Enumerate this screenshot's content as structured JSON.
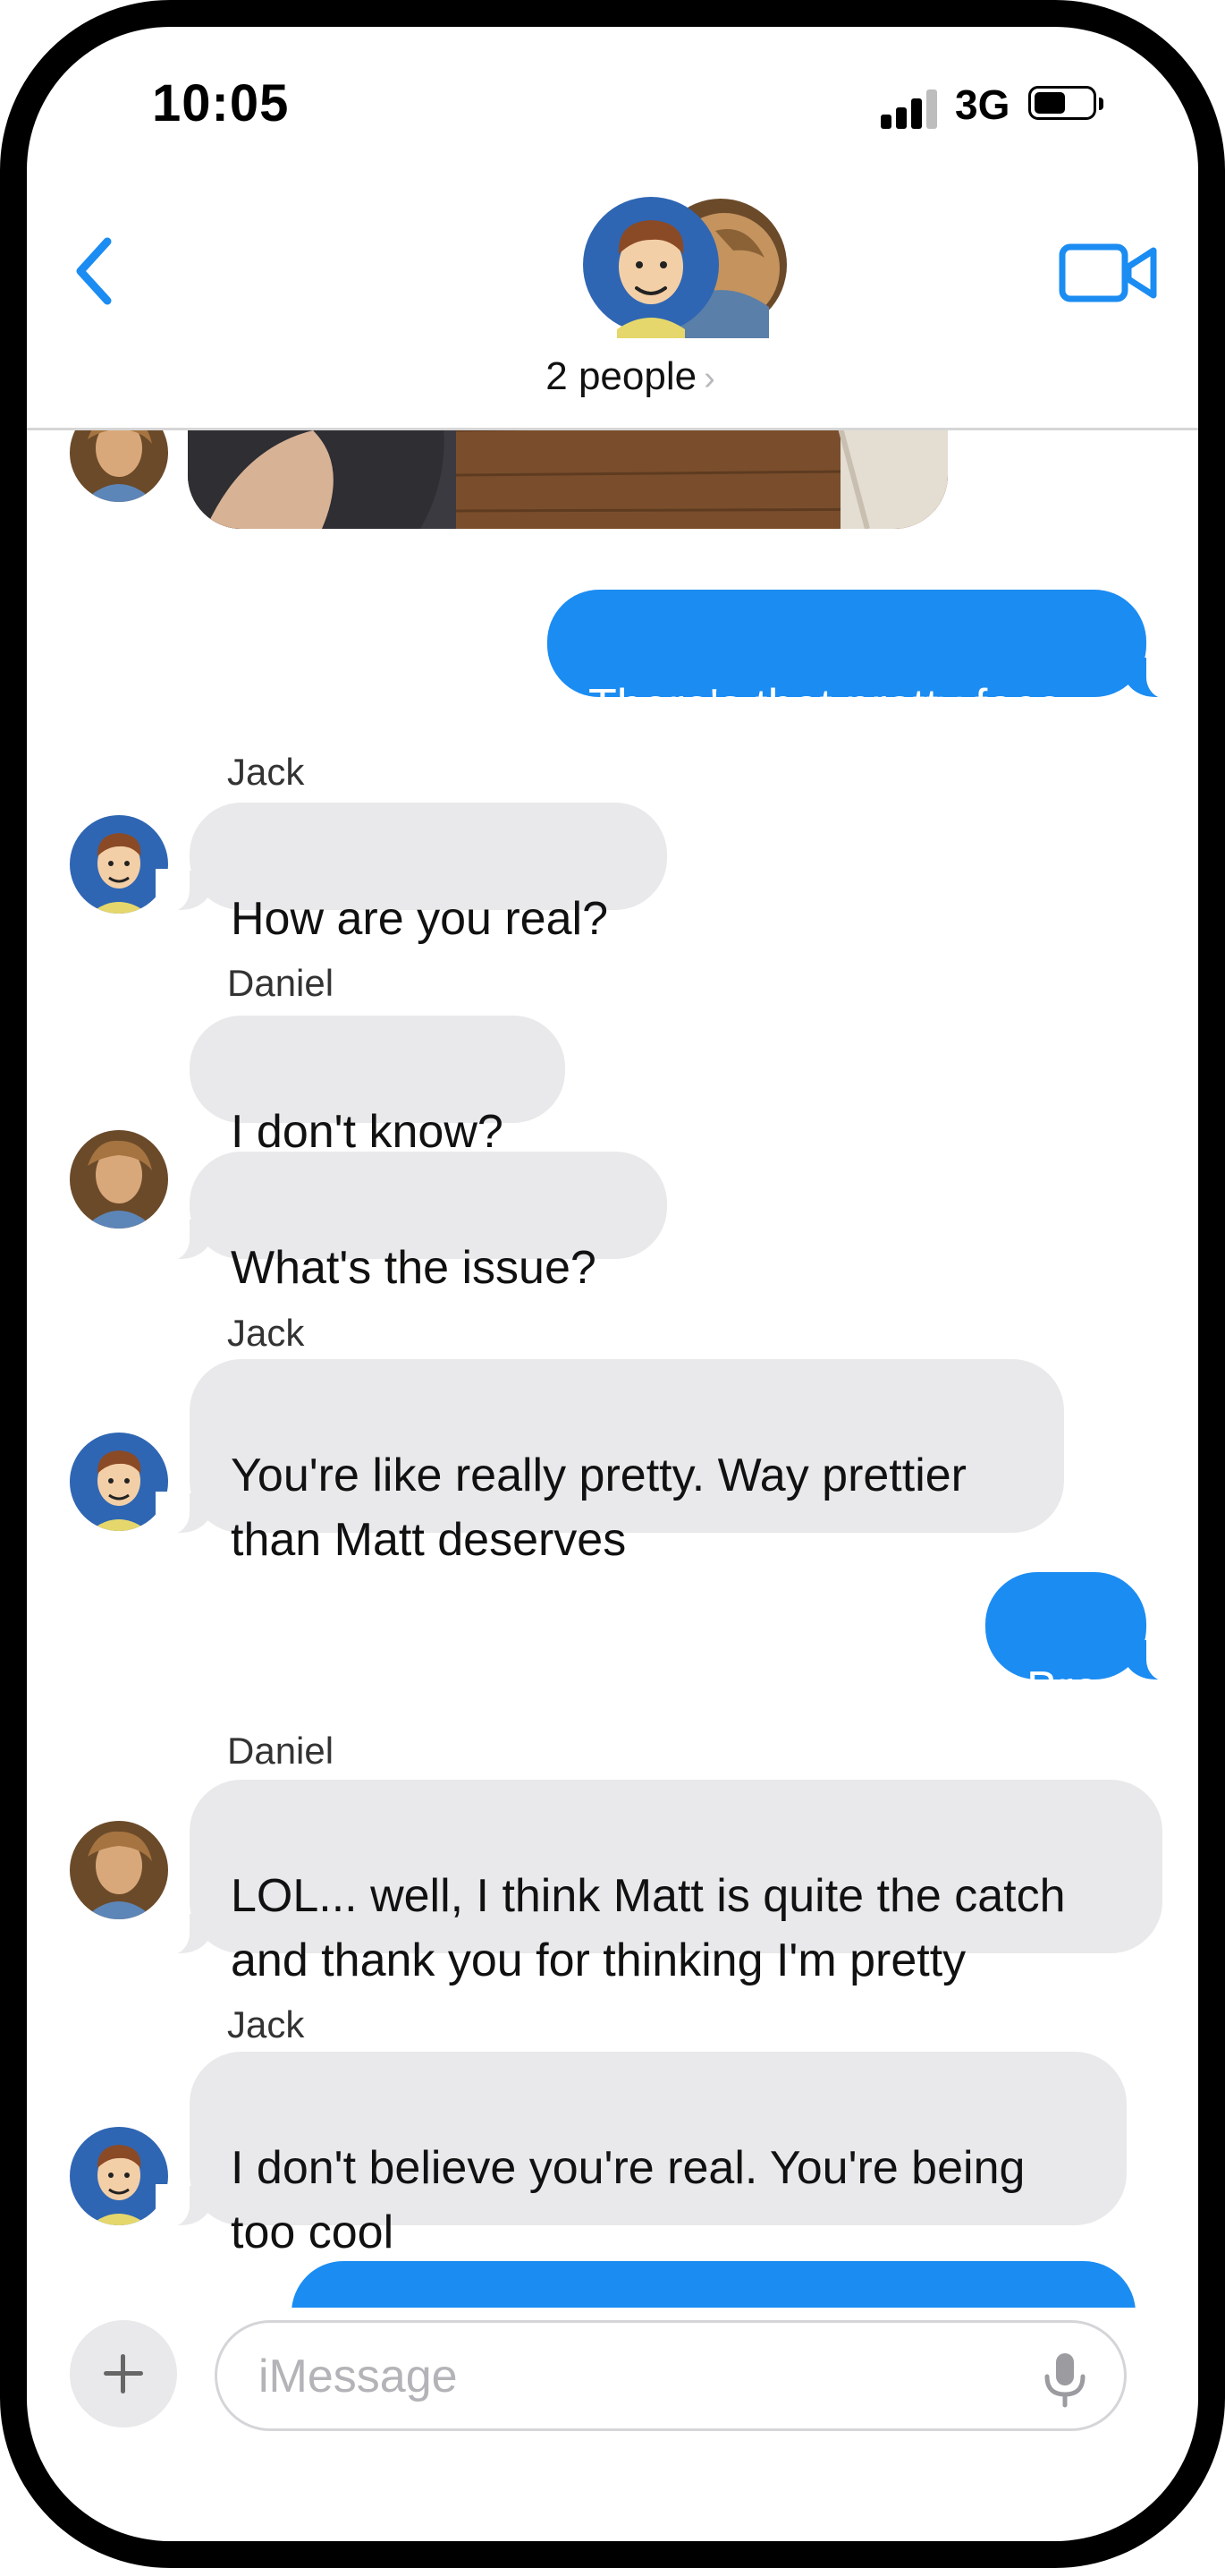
{
  "status": {
    "time": "10:05",
    "network": "3G"
  },
  "header": {
    "people_label": "2 people"
  },
  "messages": [
    {
      "sender": "",
      "text": "There's that pretty face"
    },
    {
      "sender": "Jack",
      "text": "How are you real?"
    },
    {
      "sender": "Daniel",
      "text": "I don't know?"
    },
    {
      "sender": "",
      "text": "What's the issue?"
    },
    {
      "sender": "Jack",
      "text": "You're like really pretty.  Way prettier\nthan Matt deserves"
    },
    {
      "sender": "",
      "text": "Bro"
    },
    {
      "sender": "Daniel",
      "text": "LOL... well, I think Matt is quite the catch\nand thank you for thinking I'm pretty"
    },
    {
      "sender": "Jack",
      "text": "I don't believe you're real.  You're being\ntoo cool"
    }
  ],
  "composer": {
    "placeholder": "iMessage"
  },
  "colors": {
    "accent": "#1b8cf2",
    "incoming_bubble": "#e9e9eb",
    "background": "#ffffff"
  }
}
